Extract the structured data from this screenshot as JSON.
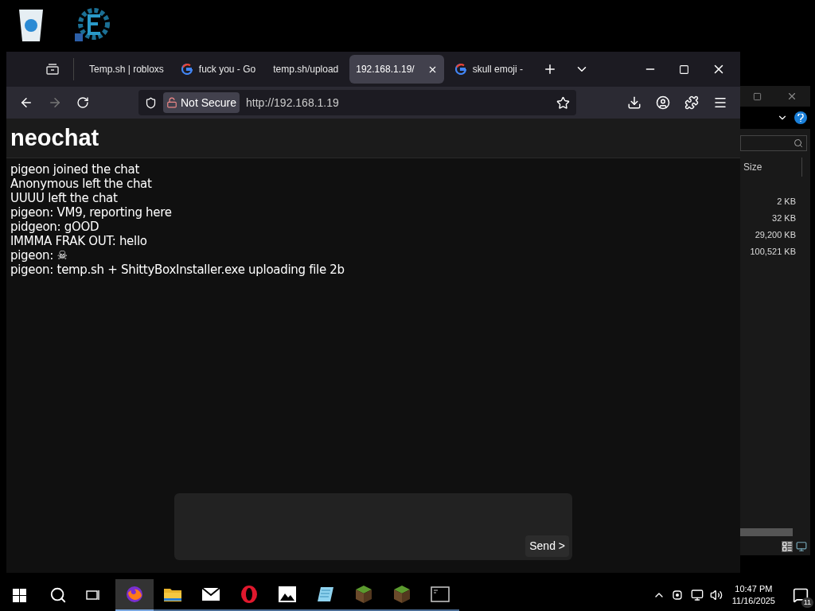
{
  "browser": {
    "tabs": [
      {
        "label": "Temp.sh | robloxs",
        "kind": "plain",
        "selected": false
      },
      {
        "label": "fuck you - Go",
        "kind": "google",
        "selected": false
      },
      {
        "label": "temp.sh/upload",
        "kind": "plain",
        "selected": false
      },
      {
        "label": "192.168.1.19/",
        "kind": "plain",
        "selected": true
      },
      {
        "label": "skull emoji -",
        "kind": "google",
        "selected": false
      }
    ],
    "address": {
      "security": "Not Secure",
      "url": "http://192.168.1.19"
    }
  },
  "page": {
    "title": "neochat",
    "messages": [
      "pigeon joined the chat",
      "Anonymous left the chat",
      "UUUU left the chat",
      "pigeon: VM9, reporting here",
      "pidgeon: gOOD",
      "IMMMA FRAK OUT: hello",
      "pigeon: ☠",
      "pigeon: temp.sh + ShittyBoxInstaller.exe uploading file 2b"
    ],
    "send_button": "Send >"
  },
  "explorer": {
    "column": "Size",
    "sizes": [
      "2 KB",
      "32 KB",
      "29,200 KB",
      "100,521 KB"
    ]
  },
  "taskbar": {
    "apps": [
      {
        "kind": "firefox",
        "selected": true
      },
      {
        "kind": "folder",
        "selected": false
      },
      {
        "kind": "mail",
        "selected": false
      },
      {
        "kind": "opera",
        "selected": false
      },
      {
        "kind": "photos",
        "selected": false
      },
      {
        "kind": "notepad",
        "selected": false
      },
      {
        "kind": "grass",
        "selected": false
      },
      {
        "kind": "grass",
        "selected": false
      },
      {
        "kind": "terminal",
        "selected": false
      }
    ],
    "time": "10:47 PM",
    "date": "11/16/2025",
    "notifications": "11"
  }
}
